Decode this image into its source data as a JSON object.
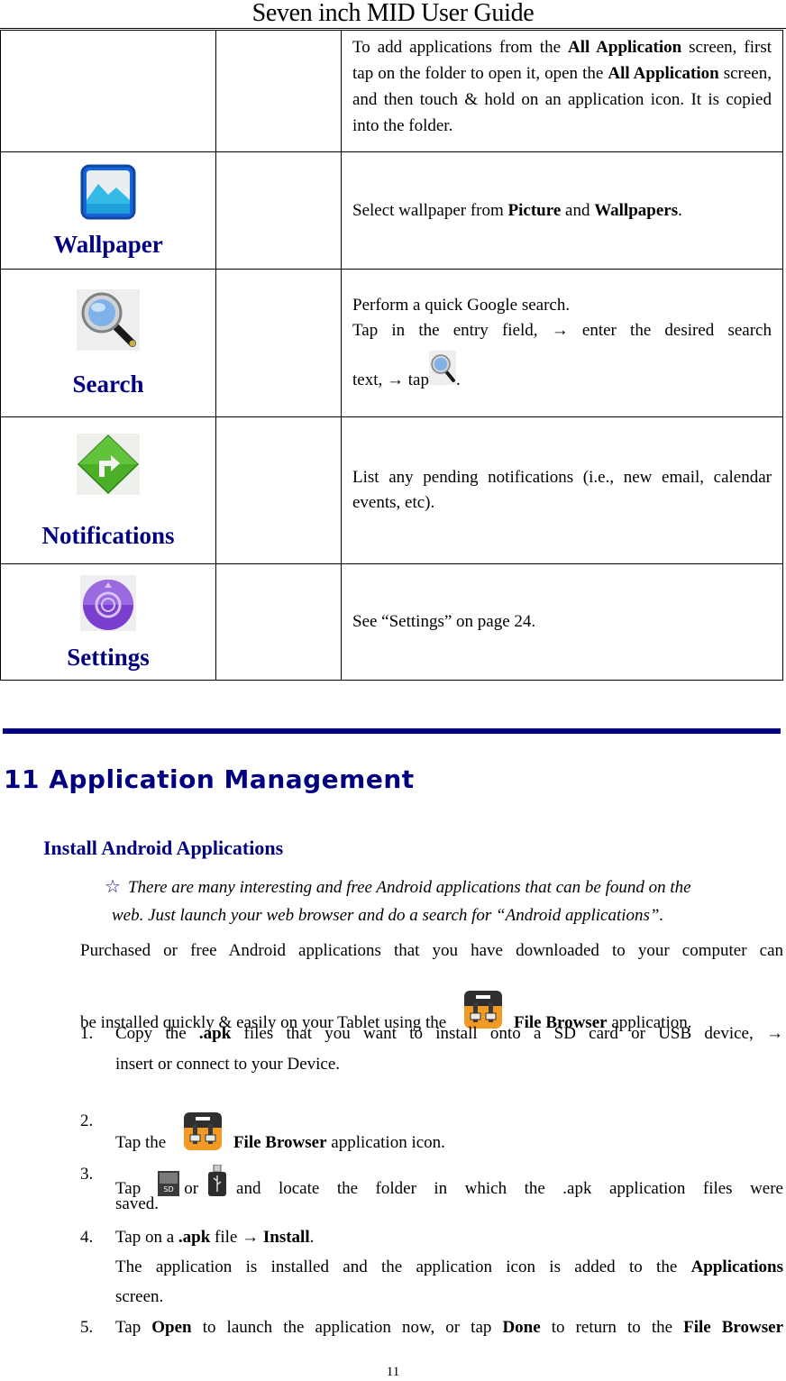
{
  "header": {
    "title": "Seven inch MID User Guide"
  },
  "table": {
    "rows": [
      {
        "name": "",
        "icon": "",
        "desc_parts": [
          "To add applications from the ",
          "All Application",
          " screen, first tap on the folder to open it, open the ",
          "All Application",
          " screen, and then touch & hold on an application icon. It is copied into the folder."
        ]
      },
      {
        "name": "Wallpaper",
        "icon": "wallpaper-icon",
        "desc_parts": [
          "Select wallpaper from ",
          "Picture",
          " and ",
          "Wallpapers",
          "."
        ]
      },
      {
        "name": "Search",
        "icon": "magnifier-icon",
        "desc_line1": "Perform a quick Google search.",
        "desc_line2": "Tap in the entry field, → enter the desired search",
        "desc_line3_pre": "text, → tap",
        "desc_line3_post": "."
      },
      {
        "name": "Notifications",
        "icon": "turn-arrow-icon",
        "desc": "List any pending notifications (i.e., new email, calendar events, etc)."
      },
      {
        "name": "Settings",
        "icon": "gear-icon",
        "desc": "See “Settings” on page 24."
      }
    ]
  },
  "section": {
    "title": "11 Application Management",
    "subtitle": "Install Android Applications",
    "tip_symbol": "☆",
    "tip_line1": "There are many interesting and free Android applications that can be found on the",
    "tip_line2": "web. Just launch your web browser and do a search for “Android applications”.",
    "intro_line1": "Purchased or free Android applications that you have downloaded to your computer can",
    "intro_line2_pre": "be installed quickly & easily on your Tablet using the",
    "intro_line2_bold": "File Browser",
    "intro_line2_post": " application.",
    "steps": [
      {
        "num": "1.",
        "l1_pre": "Copy the ",
        "l1_bold": ".apk",
        "l1_post": " files that you want to install onto a SD card or USB device, →",
        "l2": "insert or connect to your Device."
      },
      {
        "num": "2.",
        "pre": "Tap the",
        "bold": "File Browser",
        "post": " application icon."
      },
      {
        "num": "3.",
        "pre": "Tap",
        "mid": "or",
        "post": "and locate the folder in which the .apk application files were",
        "l2": "saved."
      },
      {
        "num": "4.",
        "pre": "Tap on a ",
        "bold1": ".apk",
        "mid": " file → ",
        "bold2": "Install",
        "post": ".",
        "l2_pre": "The application is installed and the application icon is added to the ",
        "l2_bold": "Applications",
        "l3": "screen."
      },
      {
        "num": "5.",
        "p1": "Tap ",
        "b1": "Open",
        "p2": " to launch the application now, or tap ",
        "b2": "Done",
        "p3": " to return to the ",
        "b3": "File Browser"
      }
    ]
  },
  "footer": {
    "page_number": "11"
  },
  "colors": {
    "heading_blue": "#000080",
    "rule_blue": "#000080"
  }
}
